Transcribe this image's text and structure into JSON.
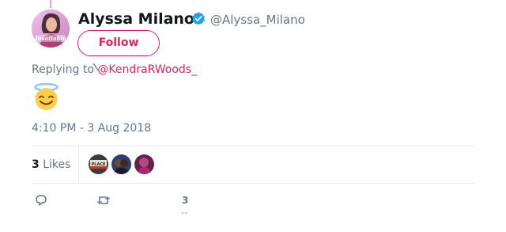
{
  "colors": {
    "accent": "#e0245e",
    "secondary_text": "#657786",
    "verified": "#1da1f2",
    "divider": "#e6ecf0"
  },
  "user": {
    "display_name": "Alyssa Milano",
    "handle": "@Alyssa_Milano",
    "verified": true,
    "avatar_text": "Insatiable"
  },
  "follow_button": {
    "label": "Follow"
  },
  "reply": {
    "prefix": "Replying to",
    "to_handle": "@KendraRWoods_"
  },
  "content": {
    "emoji": "smiling-face-with-halo-icon"
  },
  "timestamp": "4:10 PM - 3 Aug 2018",
  "stats": {
    "likes_count": "3",
    "likes_label": "Likes",
    "liker_avatars": [
      "liker-avatar-1",
      "liker-avatar-2",
      "liker-avatar-3"
    ],
    "liker_avatar_1_text": "PLACE"
  },
  "actions": {
    "reply_icon": "reply-icon",
    "retweet_icon": "retweet-icon",
    "like_count": "3",
    "like_dash": "--"
  }
}
